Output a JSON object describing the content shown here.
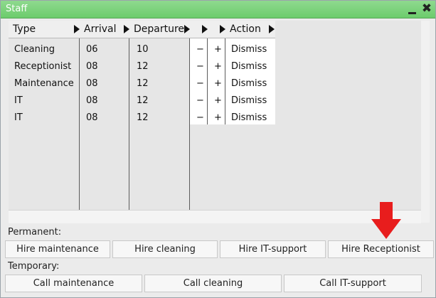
{
  "window": {
    "title": "Staff"
  },
  "table": {
    "columns": [
      "Type",
      "Arrival",
      "Departure",
      "",
      "",
      "Action"
    ],
    "rows": [
      {
        "type": "Cleaning",
        "arrival": "06",
        "departure": "10",
        "minus": "−",
        "plus": "+",
        "action": "Dismiss"
      },
      {
        "type": "Receptionist",
        "arrival": "08",
        "departure": "12",
        "minus": "−",
        "plus": "+",
        "action": "Dismiss"
      },
      {
        "type": "Maintenance",
        "arrival": "08",
        "departure": "12",
        "minus": "−",
        "plus": "+",
        "action": "Dismiss"
      },
      {
        "type": "IT",
        "arrival": "08",
        "departure": "12",
        "minus": "−",
        "plus": "+",
        "action": "Dismiss"
      },
      {
        "type": "IT",
        "arrival": "08",
        "departure": "12",
        "minus": "−",
        "plus": "+",
        "action": "Dismiss"
      }
    ]
  },
  "permanent": {
    "label": "Permanent:",
    "buttons": [
      "Hire maintenance",
      "Hire cleaning",
      "Hire IT-support",
      "Hire Receptionist"
    ]
  },
  "temporary": {
    "label": "Temporary:",
    "buttons": [
      "Call maintenance",
      "Call cleaning",
      "Call IT-support"
    ]
  },
  "colors": {
    "titlebar": "#6ccc6c",
    "arrow": "#e81d1d"
  },
  "icons": {
    "minimize": "minimize-icon",
    "close": "close-icon",
    "sort": "triangle-right-icon",
    "pointer": "red-down-arrow"
  }
}
